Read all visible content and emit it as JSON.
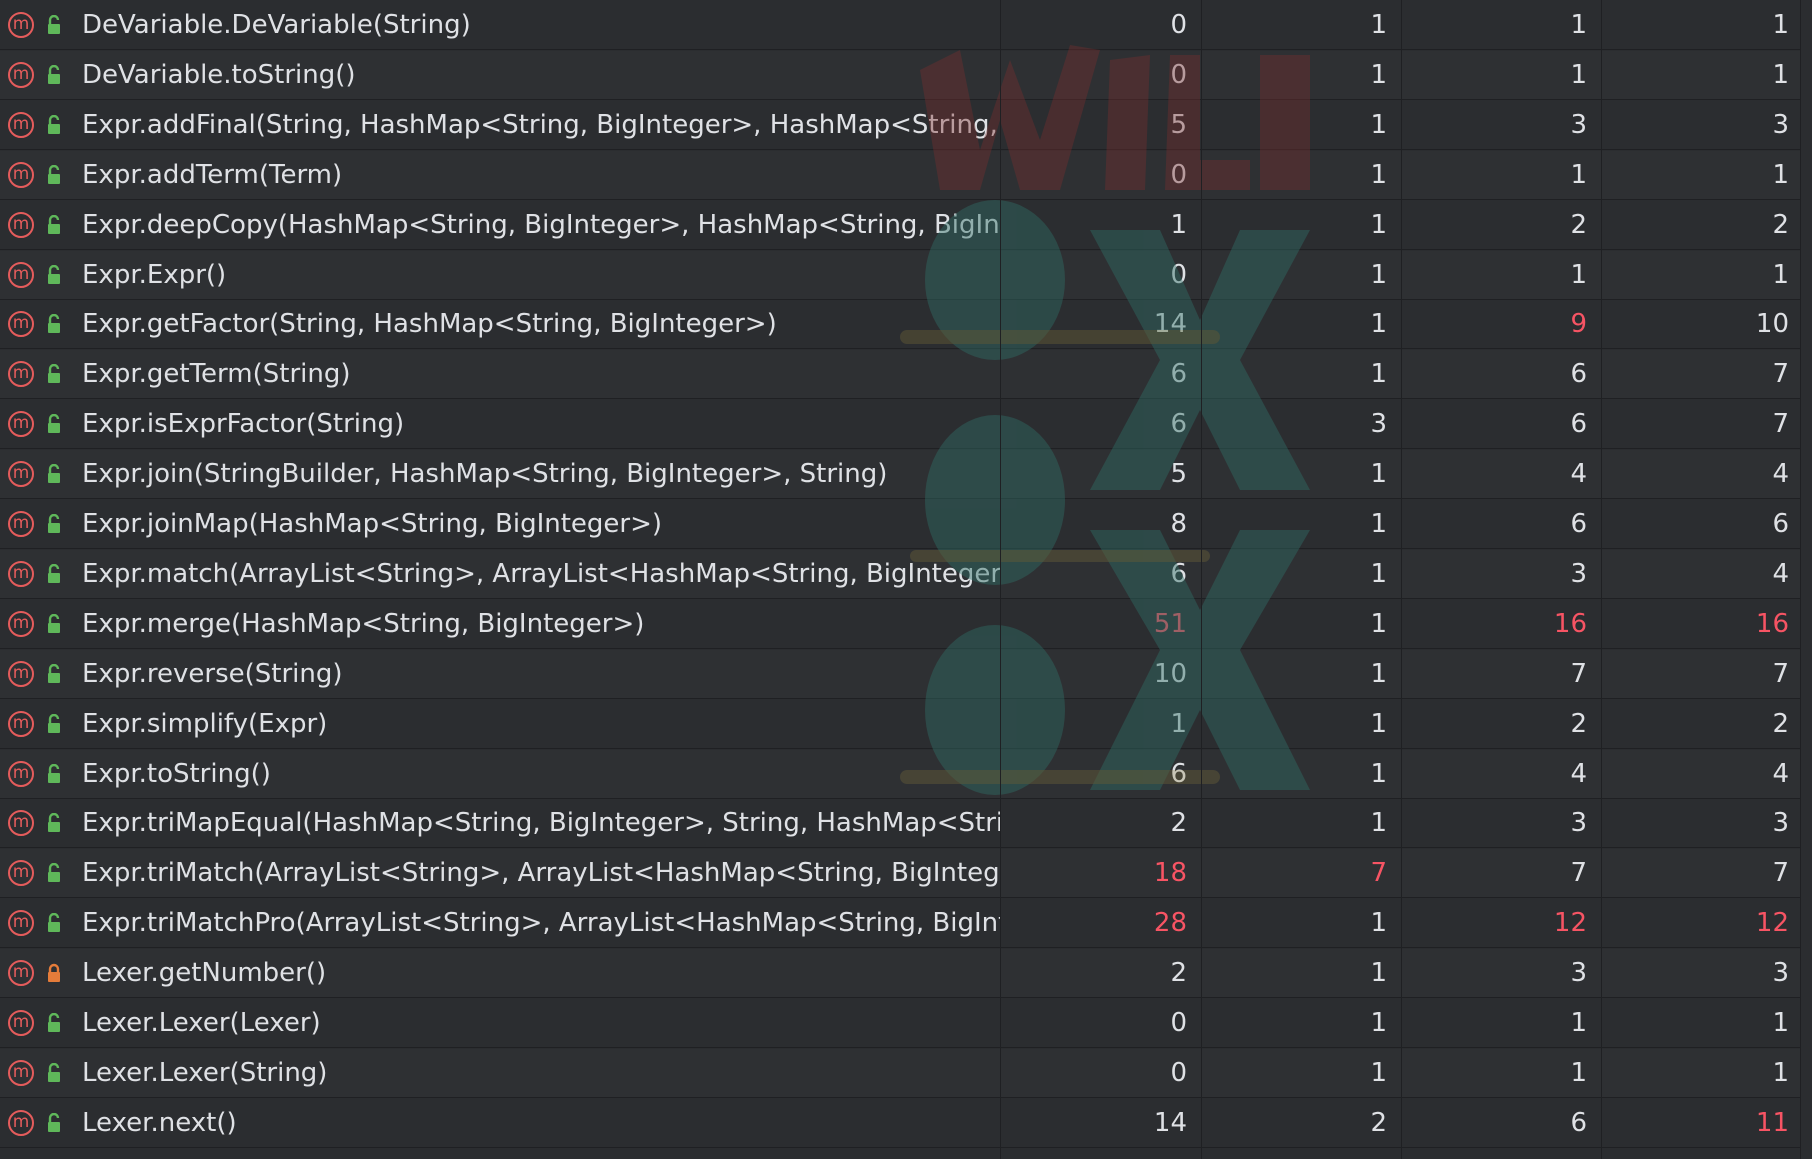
{
  "colors": {
    "warning": "#f75464",
    "method_icon": "#e55c5c",
    "public_icon": "#5fb85a",
    "private_icon": "#e57c3a"
  },
  "rows": [
    {
      "name": "DeVariable.DeVariable(String)",
      "access": "public",
      "v": [
        "0",
        "1",
        "1",
        "1"
      ],
      "warn": [
        false,
        false,
        false,
        false
      ]
    },
    {
      "name": "DeVariable.toString()",
      "access": "public",
      "v": [
        "0",
        "1",
        "1",
        "1"
      ],
      "warn": [
        false,
        false,
        false,
        false
      ]
    },
    {
      "name": "Expr.addFinal(String, HashMap<String, BigInteger>, HashMap<String, BigIr",
      "access": "public",
      "v": [
        "5",
        "1",
        "3",
        "3"
      ],
      "warn": [
        false,
        false,
        false,
        false
      ]
    },
    {
      "name": "Expr.addTerm(Term)",
      "access": "public",
      "v": [
        "0",
        "1",
        "1",
        "1"
      ],
      "warn": [
        false,
        false,
        false,
        false
      ]
    },
    {
      "name": "Expr.deepCopy(HashMap<String, BigInteger>, HashMap<String, BigIntegei",
      "access": "public",
      "v": [
        "1",
        "1",
        "2",
        "2"
      ],
      "warn": [
        false,
        false,
        false,
        false
      ]
    },
    {
      "name": "Expr.Expr()",
      "access": "public",
      "v": [
        "0",
        "1",
        "1",
        "1"
      ],
      "warn": [
        false,
        false,
        false,
        false
      ]
    },
    {
      "name": "Expr.getFactor(String, HashMap<String, BigInteger>)",
      "access": "public",
      "v": [
        "14",
        "1",
        "9",
        "10"
      ],
      "warn": [
        false,
        false,
        true,
        false
      ]
    },
    {
      "name": "Expr.getTerm(String)",
      "access": "public",
      "v": [
        "6",
        "1",
        "6",
        "7"
      ],
      "warn": [
        false,
        false,
        false,
        false
      ]
    },
    {
      "name": "Expr.isExprFactor(String)",
      "access": "public",
      "v": [
        "6",
        "3",
        "6",
        "7"
      ],
      "warn": [
        false,
        false,
        false,
        false
      ]
    },
    {
      "name": "Expr.join(StringBuilder, HashMap<String, BigInteger>, String)",
      "access": "public",
      "v": [
        "5",
        "1",
        "4",
        "4"
      ],
      "warn": [
        false,
        false,
        false,
        false
      ]
    },
    {
      "name": "Expr.joinMap(HashMap<String, BigInteger>)",
      "access": "public",
      "v": [
        "8",
        "1",
        "6",
        "6"
      ],
      "warn": [
        false,
        false,
        false,
        false
      ]
    },
    {
      "name": "Expr.match(ArrayList<String>, ArrayList<HashMap<String, BigInteger>>, H",
      "access": "public",
      "v": [
        "6",
        "1",
        "3",
        "4"
      ],
      "warn": [
        false,
        false,
        false,
        false
      ]
    },
    {
      "name": "Expr.merge(HashMap<String, BigInteger>)",
      "access": "public",
      "v": [
        "51",
        "1",
        "16",
        "16"
      ],
      "warn": [
        true,
        false,
        true,
        true
      ]
    },
    {
      "name": "Expr.reverse(String)",
      "access": "public",
      "v": [
        "10",
        "1",
        "7",
        "7"
      ],
      "warn": [
        false,
        false,
        false,
        false
      ]
    },
    {
      "name": "Expr.simplify(Expr)",
      "access": "public",
      "v": [
        "1",
        "1",
        "2",
        "2"
      ],
      "warn": [
        false,
        false,
        false,
        false
      ]
    },
    {
      "name": "Expr.toString()",
      "access": "public",
      "v": [
        "6",
        "1",
        "4",
        "4"
      ],
      "warn": [
        false,
        false,
        false,
        false
      ]
    },
    {
      "name": "Expr.triMapEqual(HashMap<String, BigInteger>, String, HashMap<String, B",
      "access": "public",
      "v": [
        "2",
        "1",
        "3",
        "3"
      ],
      "warn": [
        false,
        false,
        false,
        false
      ]
    },
    {
      "name": "Expr.triMatch(ArrayList<String>, ArrayList<HashMap<String, BigInteger>>,",
      "access": "public",
      "v": [
        "18",
        "7",
        "7",
        "7"
      ],
      "warn": [
        true,
        true,
        false,
        false
      ]
    },
    {
      "name": "Expr.triMatchPro(ArrayList<String>, ArrayList<HashMap<String, BigIntegei",
      "access": "public",
      "v": [
        "28",
        "1",
        "12",
        "12"
      ],
      "warn": [
        true,
        false,
        true,
        true
      ]
    },
    {
      "name": "Lexer.getNumber()",
      "access": "private",
      "v": [
        "2",
        "1",
        "3",
        "3"
      ],
      "warn": [
        false,
        false,
        false,
        false
      ]
    },
    {
      "name": "Lexer.Lexer(Lexer)",
      "access": "public",
      "v": [
        "0",
        "1",
        "1",
        "1"
      ],
      "warn": [
        false,
        false,
        false,
        false
      ]
    },
    {
      "name": "Lexer.Lexer(String)",
      "access": "public",
      "v": [
        "0",
        "1",
        "1",
        "1"
      ],
      "warn": [
        false,
        false,
        false,
        false
      ]
    },
    {
      "name": "Lexer.next()",
      "access": "public",
      "v": [
        "14",
        "2",
        "6",
        "11"
      ],
      "warn": [
        false,
        false,
        false,
        true
      ]
    }
  ]
}
